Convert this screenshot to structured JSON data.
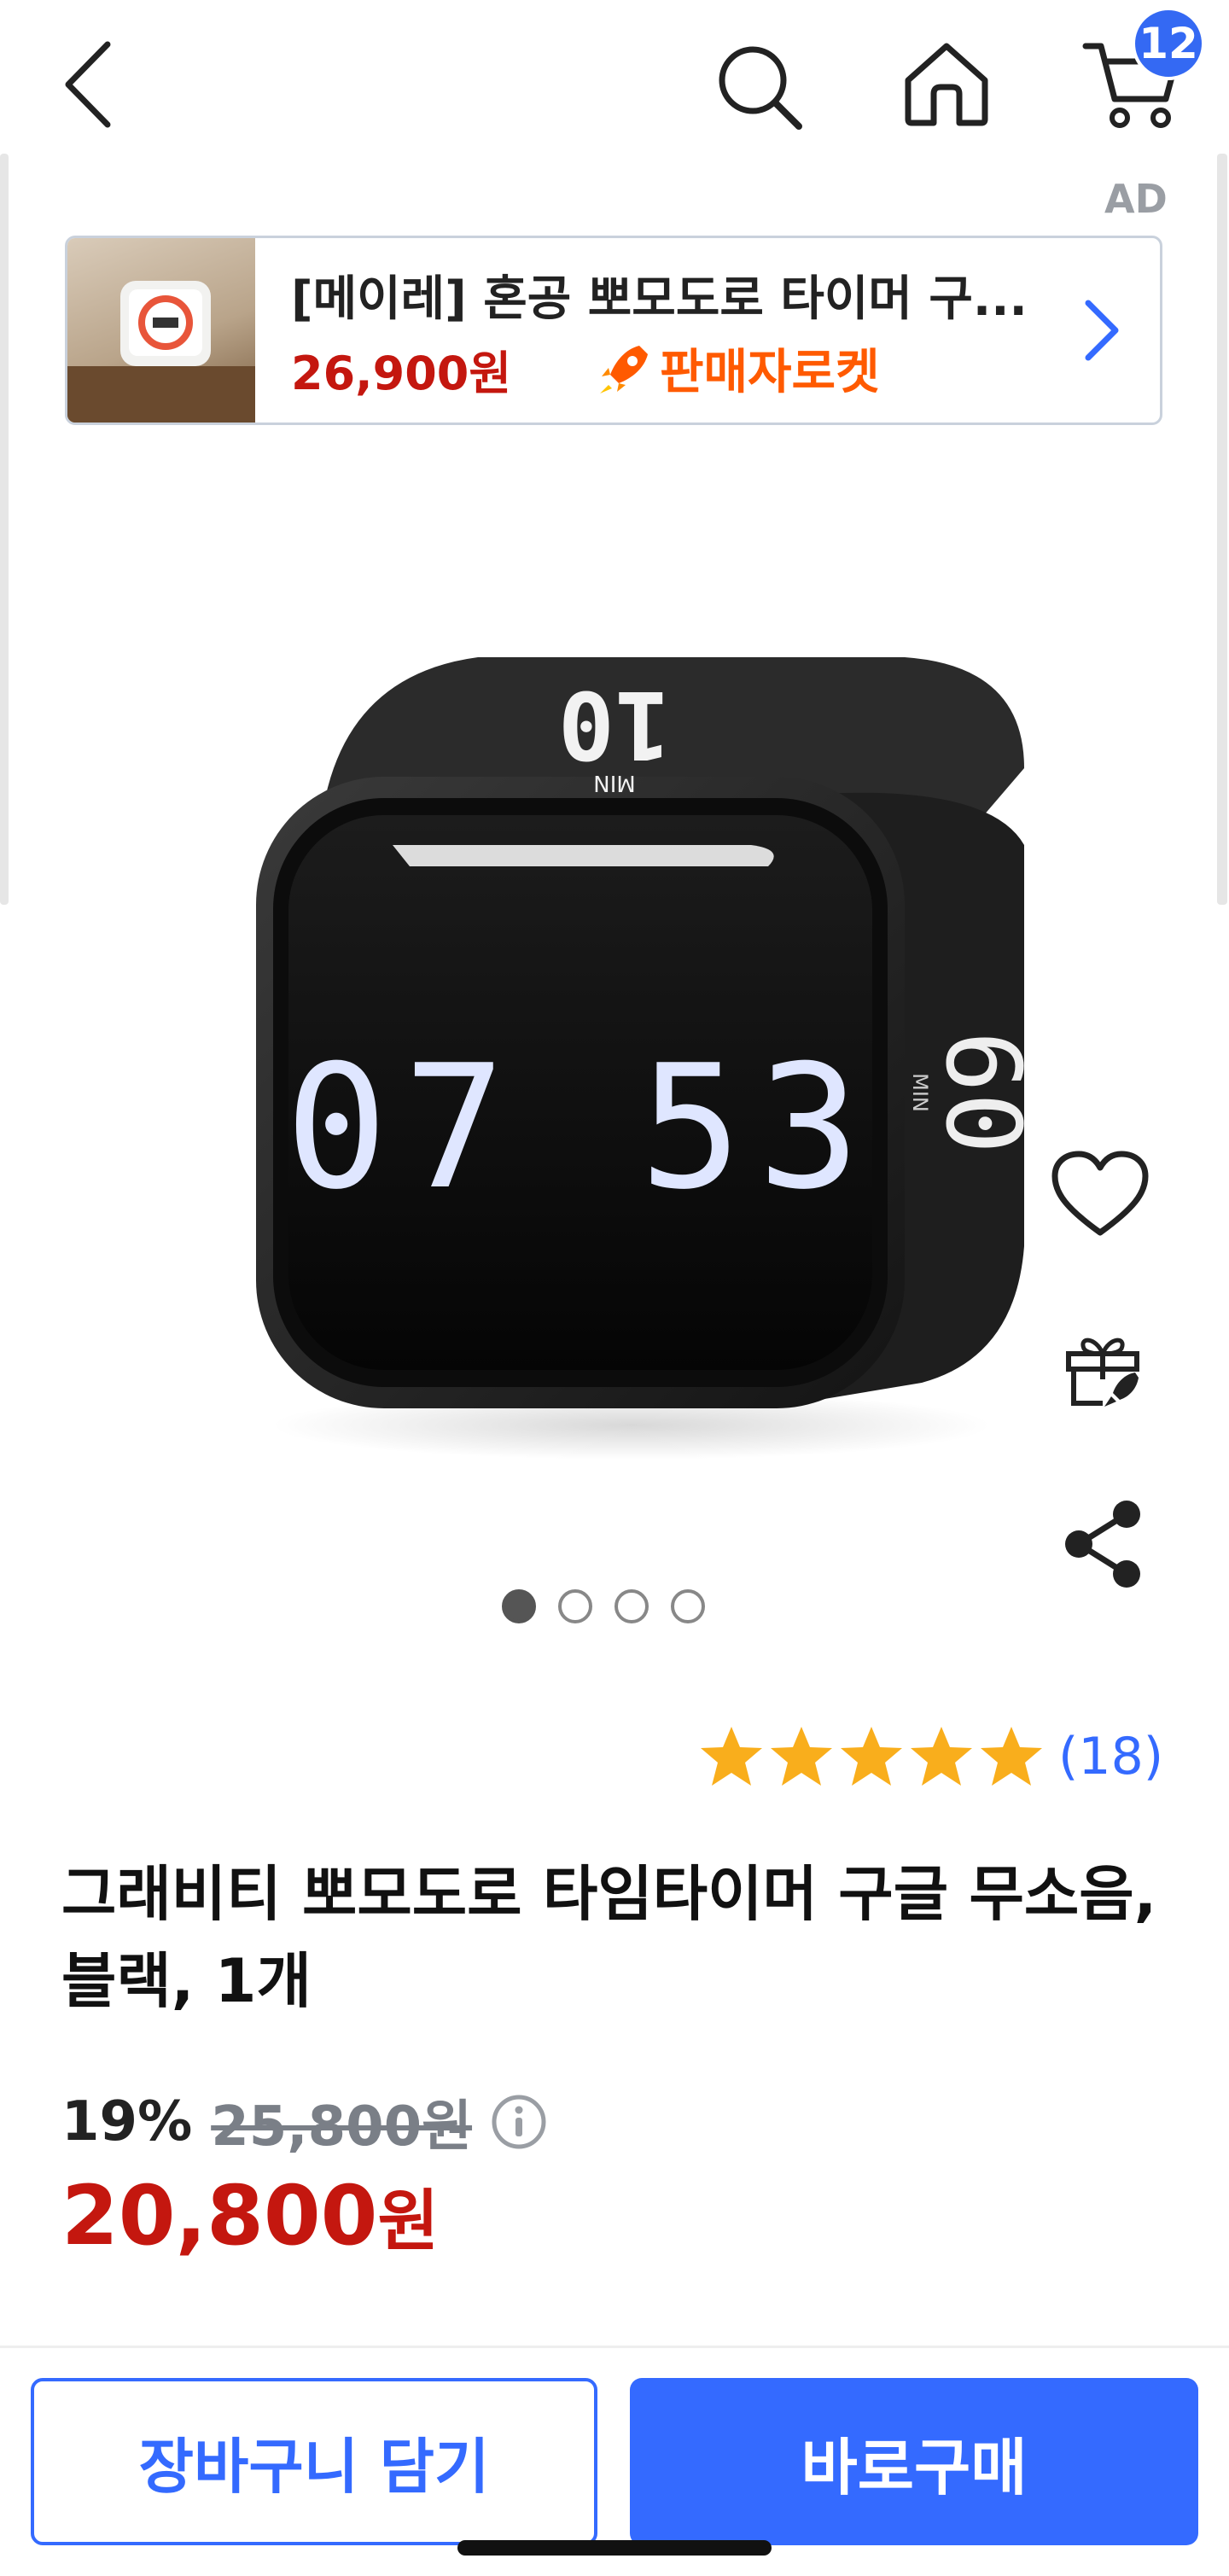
{
  "nav": {
    "icons": [
      "back-icon",
      "search-icon",
      "home-icon",
      "cart-icon"
    ],
    "cart_count": "12"
  },
  "ad": {
    "label": "AD",
    "title": "[메이레] 혼공 뽀모도로 타이머 구...",
    "price": "26,900원",
    "badge": "판매자로켓",
    "icons": [
      "rocket-icon",
      "chevron-right-icon"
    ]
  },
  "product_image": {
    "top_display_number": "10",
    "top_display_unit": "MIN",
    "front_display": "07 53",
    "side_display_number": "60",
    "side_display_unit": "MIN"
  },
  "side_actions": {
    "icons": [
      "heart-icon",
      "gift-icon",
      "share-icon"
    ]
  },
  "carousel": {
    "total": 4,
    "active_index": 0
  },
  "rating": {
    "stars": 5,
    "count": "(18)",
    "star_color": "#f9ae1c"
  },
  "product": {
    "title": "그래비티 뽀모도로 타임타이머 구글 무소음, 블랙, 1개",
    "discount": "19%",
    "original_price": "25,800원",
    "sale_price_number": "20,800",
    "sale_price_unit": "원"
  },
  "bottom_bar": {
    "cart_button": "장바구니 담기",
    "buy_button": "바로구매"
  },
  "colors": {
    "accent_blue": "#346aff",
    "price_red": "#c4170f",
    "rocket_orange": "#ff5a00"
  }
}
